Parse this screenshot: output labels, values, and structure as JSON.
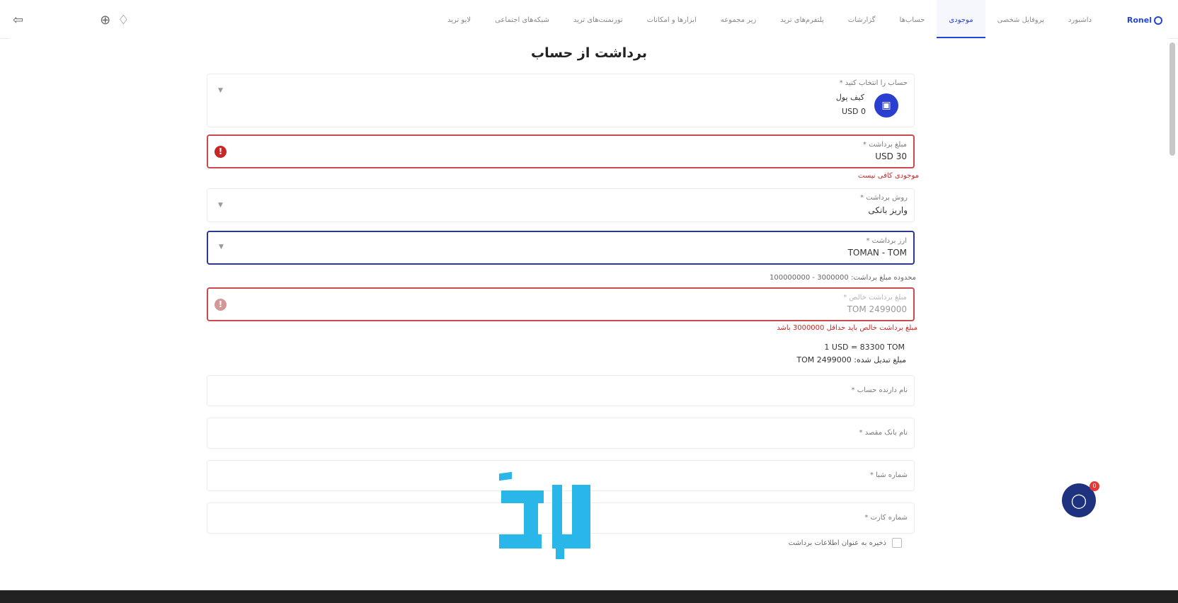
{
  "nav": {
    "logo": "Ronel",
    "items": [
      {
        "label": "داشبورد",
        "active": false
      },
      {
        "label": "پروفایل شخصی",
        "active": false
      },
      {
        "label": "موجودی",
        "active": true
      },
      {
        "label": "حساب‌ها",
        "active": false
      },
      {
        "label": "گزارشات",
        "active": false
      },
      {
        "label": "پلتفرم‌های ترید",
        "active": false
      },
      {
        "label": "زیر مجموعه",
        "active": false
      },
      {
        "label": "ابزارها و امکانات",
        "active": false
      },
      {
        "label": "تورنمنت‌های ترید",
        "active": false
      },
      {
        "label": "شبکه‌های اجتماعی",
        "active": false
      },
      {
        "label": "لایو ترید",
        "active": false
      }
    ],
    "icons": [
      "logout-icon",
      "globe-icon",
      "bell-icon"
    ]
  },
  "page": {
    "title": "برداشت از حساب"
  },
  "account": {
    "label": "حساب را انتخاب کنید *",
    "name": "کیف پول",
    "balance": "USD 0"
  },
  "amount": {
    "label": "مبلغ برداشت *",
    "value": "30 USD",
    "error": "موجودی کافی نیست"
  },
  "method": {
    "label": "روش برداشت *",
    "value": "واریز بانکی"
  },
  "currency": {
    "label": "ارز برداشت *",
    "value": "TOMAN - TOM",
    "range": "محدوده مبلغ برداشت: 3000000 - 100000000"
  },
  "net": {
    "label": "مبلغ برداشت خالص *",
    "value": "2499000 TOM",
    "error": "مبلغ برداشت خالص باید حداقل 3000000 باشد"
  },
  "conversion": {
    "rate": "1 USD = 83300 TOM",
    "converted_label": "مبلغ تبدیل شده:",
    "converted_value": "TOM 2499000"
  },
  "holder": {
    "placeholder": "نام دارنده حساب *"
  },
  "bank": {
    "placeholder": "نام بانک مقصد *"
  },
  "iban": {
    "placeholder": "شماره شبا *"
  },
  "card": {
    "placeholder": "شماره کارت *"
  },
  "save": {
    "label": "ذخیره به عنوان اطلاعات برداشت"
  },
  "chat": {
    "badge": "0"
  },
  "colors": {
    "primary": "#2345d6",
    "error": "#c62828",
    "chat": "#1e3280",
    "watermark": "#29b6e8"
  }
}
